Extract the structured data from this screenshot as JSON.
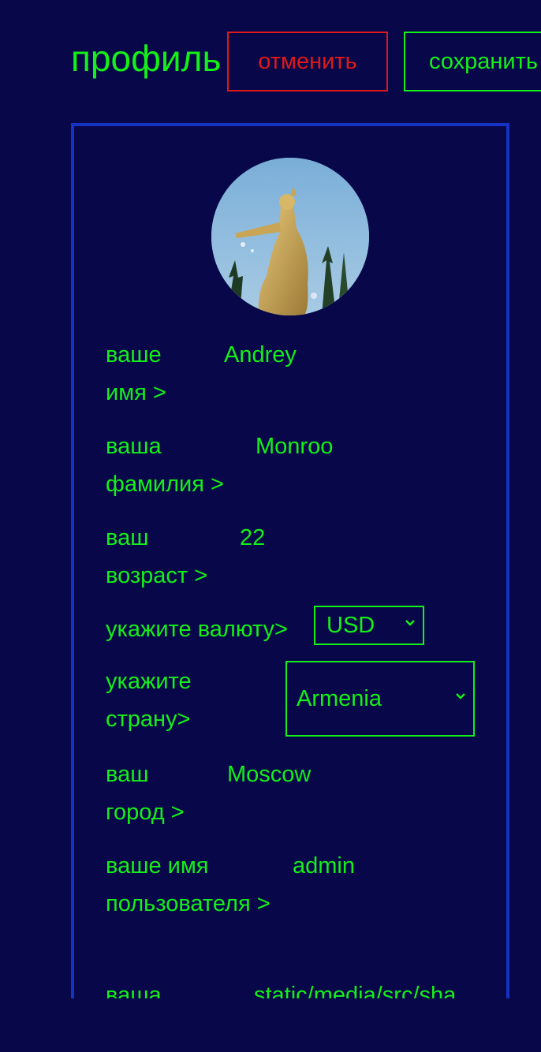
{
  "header": {
    "title": "профиль",
    "cancel_label": "отменить",
    "save_label": "сохранить"
  },
  "profile": {
    "first_name": {
      "label": "ваше имя >",
      "value": "Andrey"
    },
    "last_name": {
      "label": "ваша фамилия >",
      "value": "Monroo"
    },
    "age": {
      "label": "ваш возраст >",
      "value": "22"
    },
    "currency": {
      "label": "укажите валюту>",
      "selected": "USD"
    },
    "country": {
      "label": "укажите страну>",
      "selected": "Armenia"
    },
    "city": {
      "label": "ваш город >",
      "value": "Moscow"
    },
    "username": {
      "label": "ваше имя пользователя >",
      "value": "admin"
    },
    "photo": {
      "label": "ваша",
      "value": "static/media/src/sha"
    }
  },
  "colors": {
    "background": "#07074a",
    "text": "#14f018",
    "cancel": "#e01818",
    "panel_border": "#1433c4"
  },
  "icons": {
    "avatar": "statue-photo",
    "select_chevron": "chevron-down-icon"
  }
}
